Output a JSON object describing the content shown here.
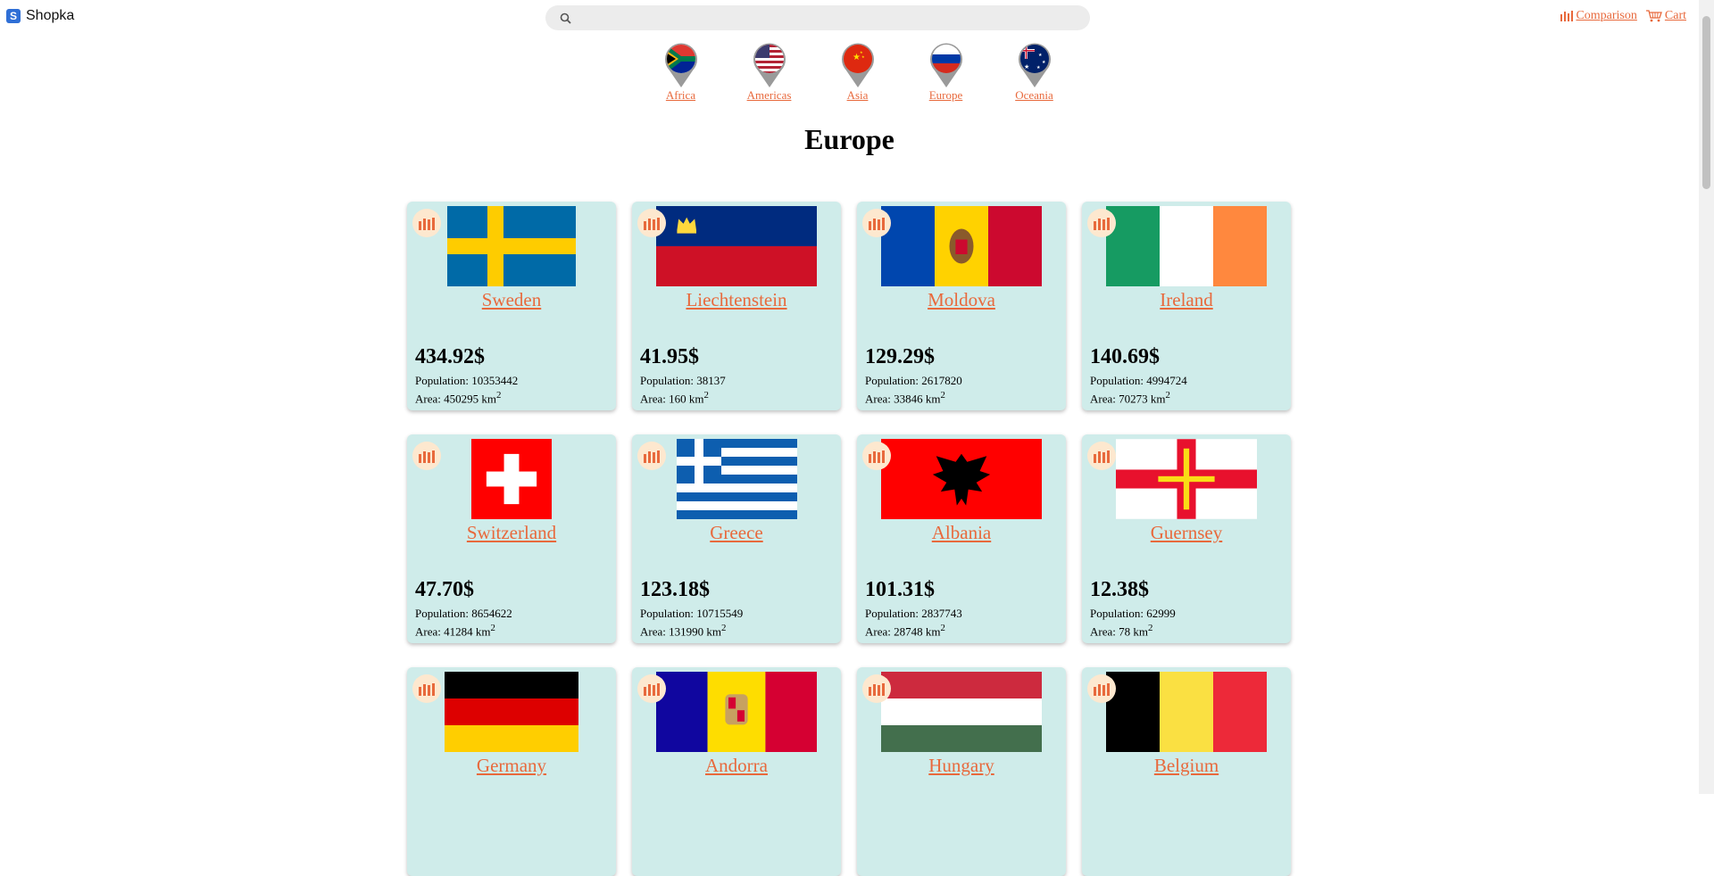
{
  "app": {
    "name": "Shopka",
    "logo_letter": "S"
  },
  "search": {
    "placeholder": "",
    "value": ""
  },
  "header_links": {
    "comparison": "Comparison",
    "cart": "Cart"
  },
  "continents": [
    {
      "label": "Africa"
    },
    {
      "label": "Americas"
    },
    {
      "label": "Asia"
    },
    {
      "label": "Europe"
    },
    {
      "label": "Oceania"
    }
  ],
  "page_title": "Europe",
  "labels": {
    "population": "Population: ",
    "area": "Area: ",
    "area_unit": " km",
    "area_exp": "2"
  },
  "countries": [
    {
      "name": "Sweden",
      "price": "434.92$",
      "population": "10353442",
      "area": "450295"
    },
    {
      "name": "Liechtenstein",
      "price": "41.95$",
      "population": "38137",
      "area": "160"
    },
    {
      "name": "Moldova",
      "price": "129.29$",
      "population": "2617820",
      "area": "33846"
    },
    {
      "name": "Ireland",
      "price": "140.69$",
      "population": "4994724",
      "area": "70273"
    },
    {
      "name": "Switzerland",
      "price": "47.70$",
      "population": "8654622",
      "area": "41284"
    },
    {
      "name": "Greece",
      "price": "123.18$",
      "population": "10715549",
      "area": "131990"
    },
    {
      "name": "Albania",
      "price": "101.31$",
      "population": "2837743",
      "area": "28748"
    },
    {
      "name": "Guernsey",
      "price": "12.38$",
      "population": "62999",
      "area": "78"
    },
    {
      "name": "Germany",
      "price": "",
      "population": "",
      "area": ""
    },
    {
      "name": "Andorra",
      "price": "",
      "population": "",
      "area": ""
    },
    {
      "name": "Hungary",
      "price": "",
      "population": "",
      "area": ""
    },
    {
      "name": "Belgium",
      "price": "",
      "population": "",
      "area": ""
    }
  ],
  "colors": {
    "accent": "#e8693c",
    "card_bg": "#cfecea",
    "logo_bg": "#2f6fd6"
  },
  "icons": {
    "search": "search-icon",
    "comparison": "bar-chart-icon",
    "cart": "cart-icon"
  }
}
